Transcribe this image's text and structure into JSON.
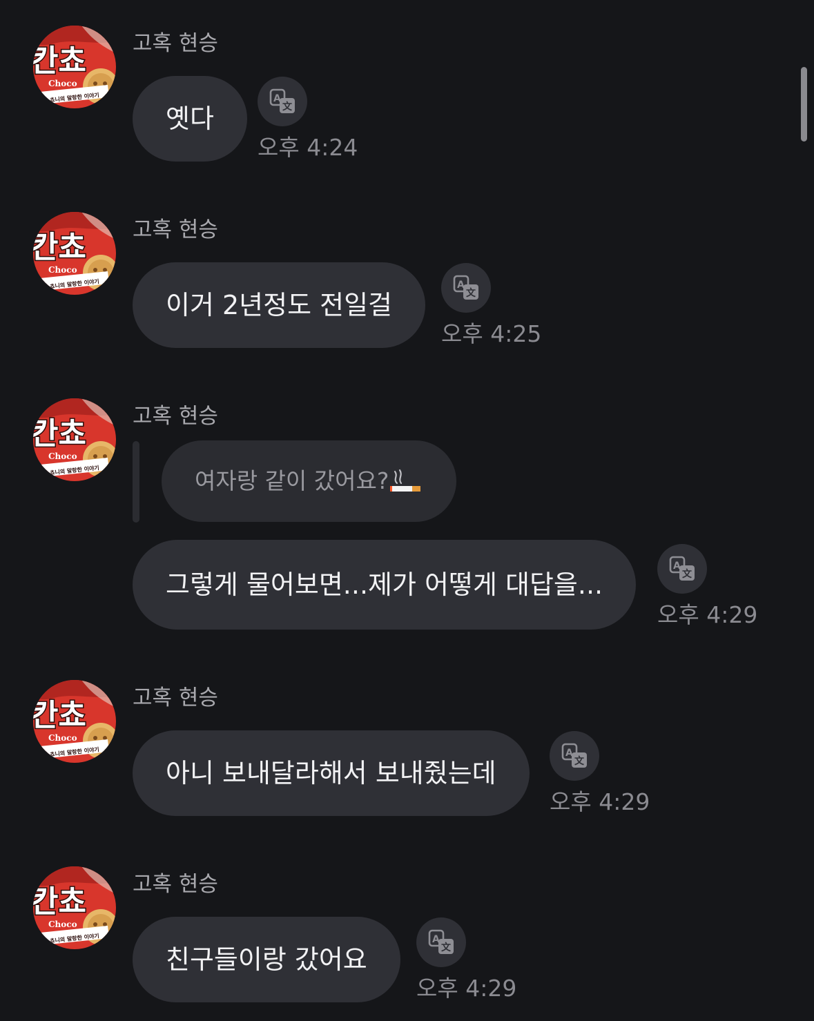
{
  "conversation": {
    "sender_name": "고혹 현승",
    "avatar": {
      "icon": "snack-package-avatar",
      "logo_text": "칸쵸",
      "brand_text": "Choco",
      "tagline_text": "쵸니의 말랑한 이야기"
    },
    "translate_icon": "translate-icon",
    "messages": [
      {
        "sender": "고혹 현승",
        "text": "옛다",
        "time": "오후 4:24"
      },
      {
        "sender": "고혹 현승",
        "text": "이거 2년정도 전일걸",
        "time": "오후 4:25"
      },
      {
        "sender": "고혹 현승",
        "reply_to": {
          "text": "여자랑 같이 갔어요?",
          "emoji": "cigarette-emoji"
        },
        "text": "그렇게 물어보면...제가 어떻게 대답을...",
        "time": "오후 4:29"
      },
      {
        "sender": "고혹 현승",
        "text": "아니 보내달라해서 보내줬는데",
        "time": "오후 4:29"
      },
      {
        "sender": "고혹 현승",
        "text": "친구들이랑 갔어요",
        "time": "오후 4:29"
      }
    ]
  },
  "colors": {
    "background": "#151619",
    "bubble": "#2f3036",
    "reply_bubble": "#2b2c31",
    "avatar_red": "#d8362c",
    "timestamp": "#8b8b91"
  }
}
